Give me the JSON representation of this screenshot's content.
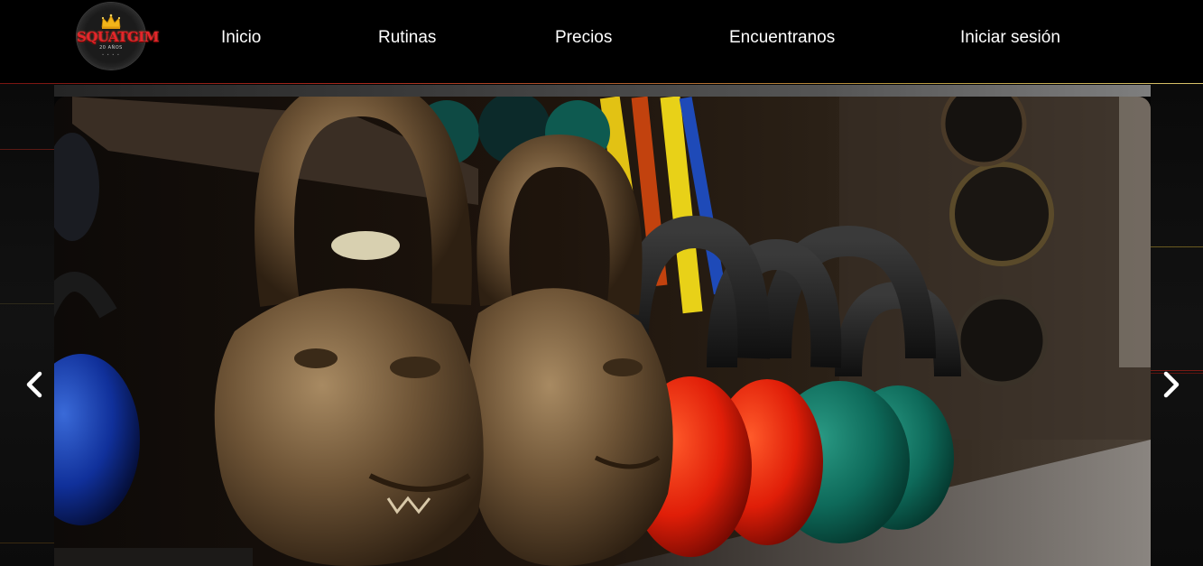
{
  "header": {
    "logo": {
      "brand": "SQUATGIM",
      "subtitle": "20 AÑOS",
      "dots": "• • • •"
    },
    "nav": [
      {
        "label": "Inicio"
      },
      {
        "label": "Rutinas"
      },
      {
        "label": "Precios"
      },
      {
        "label": "Encuentranos"
      },
      {
        "label": "Iniciar sesión"
      }
    ]
  },
  "carousel": {
    "slide_image": "kettlebells-gym-photo",
    "prev_icon": "chevron-left-icon",
    "next_icon": "chevron-right-icon"
  },
  "colors": {
    "background": "#000000",
    "accent_red": "#e3262b",
    "accent_gold": "#d8c26a",
    "nav_text": "#ffffff"
  }
}
